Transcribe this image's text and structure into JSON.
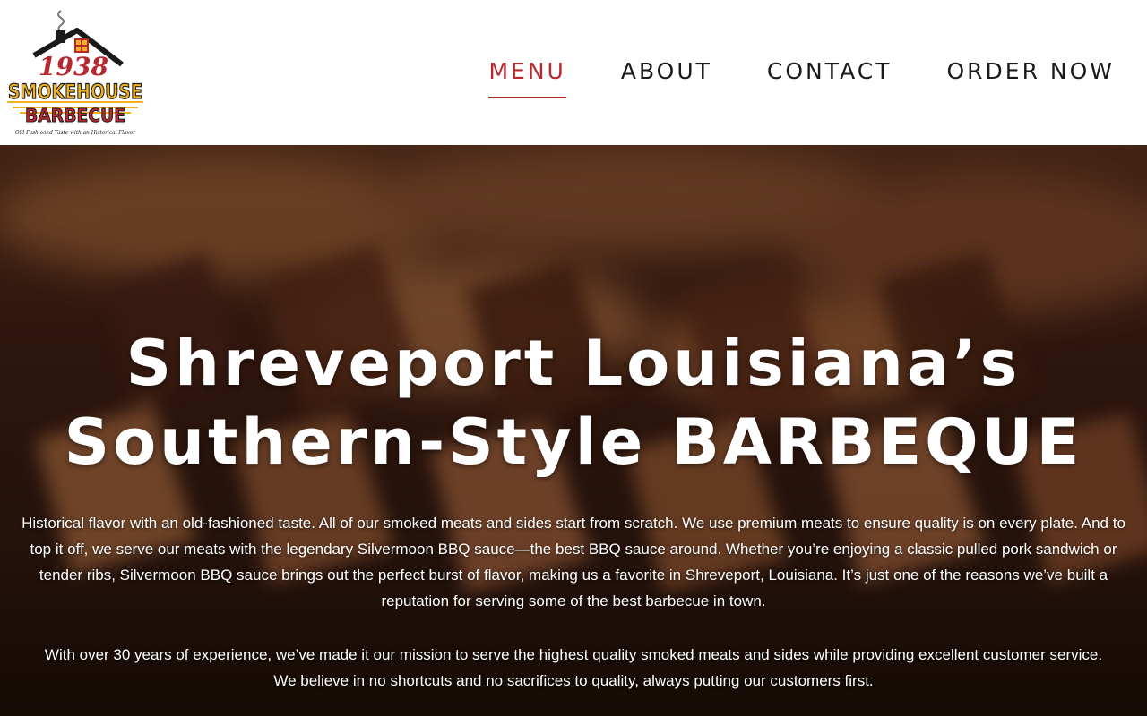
{
  "brand": {
    "logo_year": "1938",
    "logo_line1": "SMOKEHOUSE",
    "logo_line2": "BARBECUE",
    "logo_tagline": "Old Fashioned Taste with an Historical Flavor",
    "colors": {
      "red": "#b8282e",
      "gold": "#f2b21c",
      "dark": "#1a1a1a"
    }
  },
  "nav": {
    "items": [
      {
        "label": "MENU",
        "active": true
      },
      {
        "label": "ABOUT"
      },
      {
        "label": "CONTACT"
      },
      {
        "label": "ORDER NOW"
      }
    ]
  },
  "hero": {
    "title_line1": "Shreveport Louisiana’s",
    "title_line2": "Southern-Style BARBEQUE",
    "paragraph1": "Historical flavor with an old-fashioned taste. All of our smoked meats and sides start from scratch. We use premium meats to ensure quality is on every plate. And to top it off, we serve our meats with the legendary Silvermoon BBQ sauce—the best BBQ sauce around. Whether you’re enjoying a classic pulled pork sandwich or tender ribs, Silvermoon BBQ sauce brings out the perfect burst of flavor, making us a favorite in Shreveport, Louisiana. It’s just one of the reasons we’ve built a reputation for serving some of the best barbecue in town.",
    "paragraph2": "With over 30 years of experience, we’ve made it our mission to serve the highest quality smoked meats and sides while providing excellent customer service. We believe in no shortcuts and no sacrifices to quality, always putting our customers first."
  }
}
